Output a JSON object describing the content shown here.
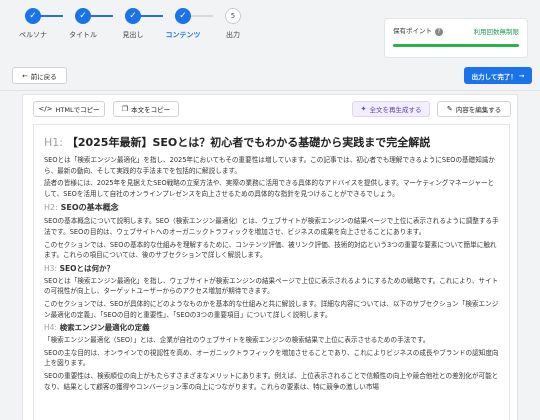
{
  "stepper": {
    "steps": [
      {
        "label": "ペルソナ",
        "state": "done"
      },
      {
        "label": "タイトル",
        "state": "done"
      },
      {
        "label": "見出し",
        "state": "done"
      },
      {
        "label": "コンテンツ",
        "state": "current"
      },
      {
        "label": "出力",
        "number": "5",
        "state": "todo"
      }
    ],
    "check": "✓"
  },
  "points": {
    "title": "保有ポイント",
    "help": "?",
    "link": "利用回数無制限",
    "progress": 1.0
  },
  "nav": {
    "back_label": "前に戻る",
    "back_icon": "←",
    "complete_label": "出力して完了！",
    "complete_icon": "→"
  },
  "toolbar": {
    "copy_html": "HTMLでコピー",
    "copy_text": "本文をコピー",
    "regenerate_all": "全文を再生成する",
    "edit_content": "内容を編集する"
  },
  "colors": {
    "accent": "#1a73e8",
    "success": "#29b34a",
    "purple": "#5b3fb0"
  },
  "doc": {
    "h1_tag": "H1:",
    "h1_text": "【2025年最新】SEOとは？初心者でもわかる基礎から実践まで完全解説",
    "p1": "SEOとは「検索エンジン最適化」を指し、2025年においてもその重要性は増しています。この記事では、初心者でも理解できるようにSEOの基礎知識から、最新の動向、そして実践的な手法までを包括的に解説します。",
    "p2": "読者の皆様には、2025年を見据えたSEO戦略の立案方法や、実際の業務に活用できる具体的なアドバイスを提供します。マーケティングマネージャーとして、SEOを活用して自社のオンラインプレゼンスを向上させるための具体的な指針を見つけることができるでしょう。",
    "h2_tag": "H2:",
    "h2_text": "SEOの基本概念",
    "p3": "SEOの基本概念について説明します。SEO（検索エンジン最適化）とは、ウェブサイトが検索エンジンの結果ページで上位に表示されるように調整する手法です。SEOの目的は、ウェブサイトへのオーガニックトラフィックを増加させ、ビジネスの成果を向上させることにあります。",
    "p4": "このセクションでは、SEOの基本的な仕組みを理解するために、コンテンツ評価、被リンク評価、技術的対応という3つの重要な要素について簡単に触れます。これらの項目については、後のサブセクションで詳しく解説します。",
    "h3_tag": "H3:",
    "h3_text": "SEOとは何か？",
    "p5": "SEOとは「検索エンジン最適化」を指し、ウェブサイトが検索エンジンの結果ページで上位に表示されるようにするための戦略です。これにより、サイトの可視性が向上し、ターゲットユーザーからのアクセス増加が期待できます。",
    "p6": "このセクションでは、SEOが具体的にどのようなものかを基本的な仕組みと共に解説します。詳細な内容については、以下のサブセクション「検索エンジン最適化の定義」、「SEOの目的と重要性」、「SEOの3つの重要項目」について詳しく説明します。",
    "h4_tag": "H4:",
    "h4_text": "検索エンジン最適化の定義",
    "p7": "「検索エンジン最適化（SEO）」とは、企業が自社のウェブサイトを検索エンジンの検索結果で上位に表示させるための手法です。",
    "p8": "SEOの主な目的は、オンラインでの視認性を高め、オーガニックトラフィックを増加させることであり、これによりビジネスの成長やブランドの認知度向上を図ります。",
    "p9": "SEOの重要性は、検索順位の向上がもたらすさまざまなメリットにあります。例えば、上位表示されることで信頼性の向上や競合他社との差別化が可能となり、結果として顧客の獲得やコンバージョン率の向上につながります。これらの要素は、特に競争の激しい市場"
  }
}
